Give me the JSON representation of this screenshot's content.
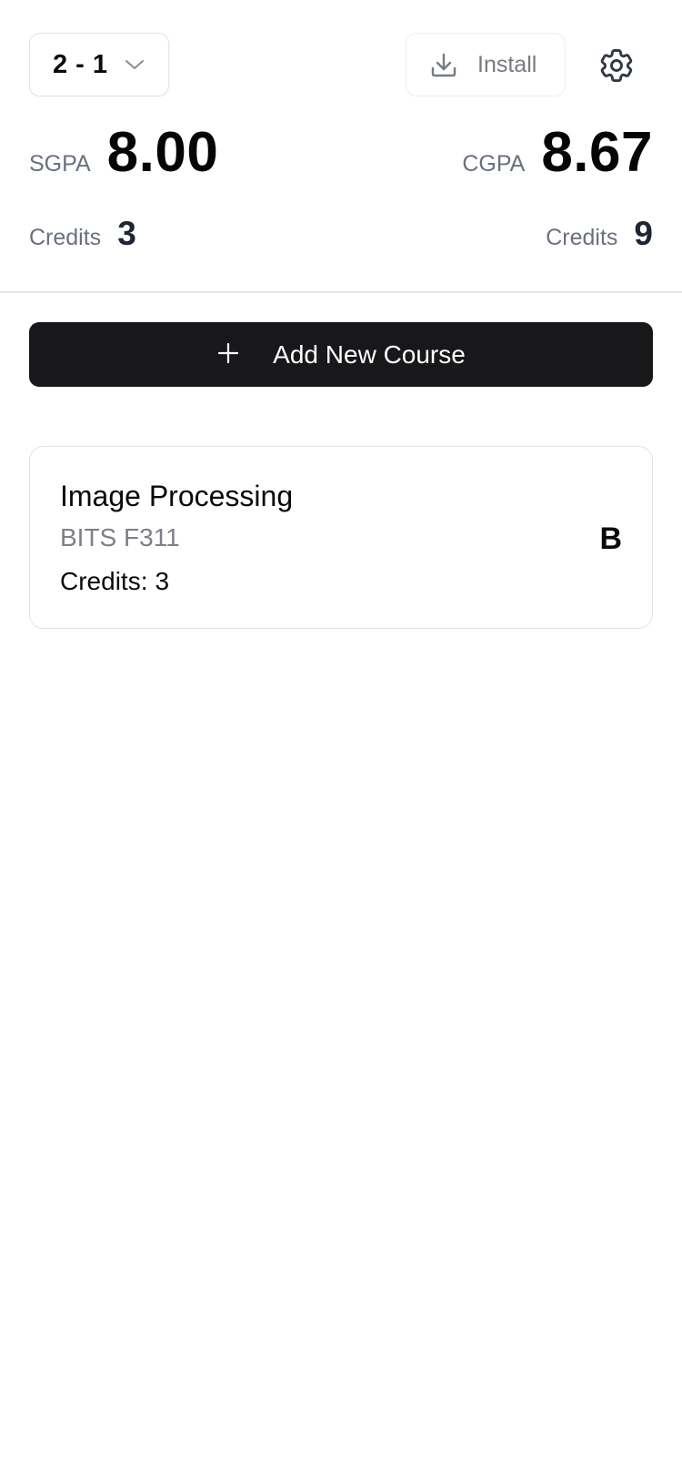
{
  "header": {
    "semester": "2 - 1",
    "install_label": "Install"
  },
  "summary": {
    "sgpa_label": "SGPA",
    "sgpa_value": "8.00",
    "cgpa_label": "CGPA",
    "cgpa_value": "8.67",
    "semester_credits_label": "Credits",
    "semester_credits_value": "3",
    "total_credits_label": "Credits",
    "total_credits_value": "9"
  },
  "actions": {
    "add_course_label": "Add New Course"
  },
  "courses": [
    {
      "name": "Image Processing",
      "code": "BITS F311",
      "credits_label": "Credits:",
      "credits": "3",
      "grade": "B"
    }
  ],
  "icons": {
    "chevron": "chevron-down-icon",
    "install": "download-icon",
    "settings": "gear-icon",
    "add": "plus-icon"
  },
  "colors": {
    "primary_button": "#18181b",
    "muted_text": "#697180",
    "border": "#e3e3e6"
  }
}
